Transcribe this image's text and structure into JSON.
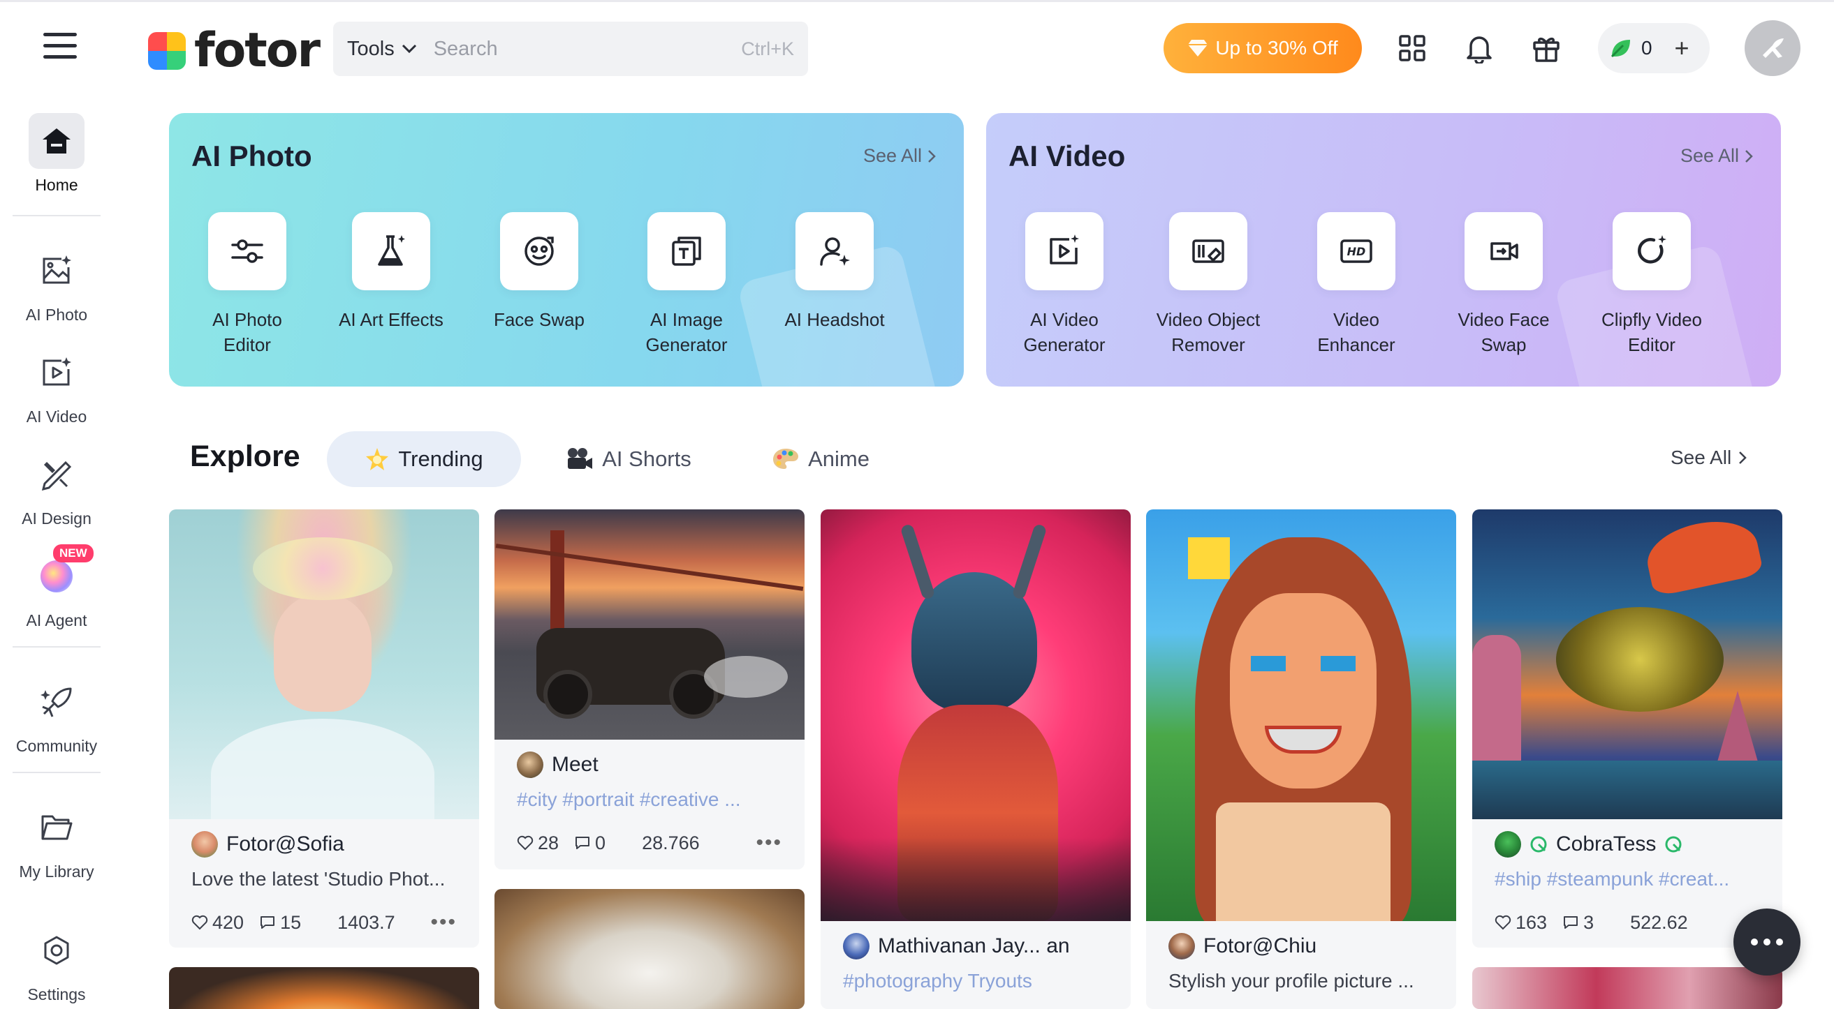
{
  "topbar": {
    "logo_text": "fotor",
    "tools_label": "Tools",
    "search_placeholder": "Search",
    "shortcut": "Ctrl+K",
    "promo_label": "Up to 30% Off",
    "credits": "0"
  },
  "sidebar": {
    "items": [
      {
        "label": "Home"
      },
      {
        "label": "AI Photo"
      },
      {
        "label": "AI Video"
      },
      {
        "label": "AI Design"
      },
      {
        "label": "AI Agent"
      },
      {
        "label": "Community"
      },
      {
        "label": "My Library"
      },
      {
        "label": "Settings"
      }
    ],
    "new_badge": "NEW"
  },
  "ai_photo": {
    "title": "AI Photo",
    "see_all": "See All",
    "tools": [
      {
        "line1": "AI Photo",
        "line2": "Editor",
        "icon": "sliders-icon"
      },
      {
        "line1": "AI Art Effects",
        "line2": "",
        "icon": "flask-icon"
      },
      {
        "line1": "Face Swap",
        "line2": "",
        "icon": "face-swap-icon"
      },
      {
        "line1": "AI Image",
        "line2": "Generator",
        "icon": "image-generator-icon"
      },
      {
        "line1": "AI Headshot",
        "line2": "",
        "icon": "headshot-icon"
      }
    ]
  },
  "ai_video": {
    "title": "AI Video",
    "see_all": "See All",
    "tools": [
      {
        "line1": "AI Video",
        "line2": "Generator",
        "icon": "video-generator-icon"
      },
      {
        "line1": "Video Object",
        "line2": "Remover",
        "icon": "object-remover-icon"
      },
      {
        "line1": "Video",
        "line2": "Enhancer",
        "icon": "hd-icon"
      },
      {
        "line1": "Video Face",
        "line2": "Swap",
        "icon": "video-face-swap-icon"
      },
      {
        "line1": "Clipfly Video",
        "line2": "Editor",
        "icon": "clipfly-icon"
      }
    ]
  },
  "explore": {
    "title": "Explore",
    "tabs": [
      {
        "label": "Trending",
        "active": true
      },
      {
        "label": "AI Shorts",
        "active": false
      },
      {
        "label": "Anime",
        "active": false
      }
    ],
    "see_all": "See All"
  },
  "cards": [
    {
      "author": "Fotor@Sofia",
      "desc": "Love the latest 'Studio Phot...",
      "likes": "420",
      "comments": "15",
      "score": "1403.7"
    },
    {
      "author": "Meet",
      "desc": "#city #portrait #creative ...",
      "likes": "28",
      "comments": "0",
      "score": "28.766"
    },
    {
      "author": "Mathivanan Jay... an",
      "desc": "#photography Tryouts"
    },
    {
      "author": "Fotor@Chiu",
      "desc": "Stylish your profile picture ..."
    },
    {
      "author": "CobraTess",
      "desc": "#ship #steampunk #creat...",
      "likes": "163",
      "comments": "3",
      "score": "522.62"
    }
  ],
  "colors": {
    "promo": "#ff9a2b",
    "tag": "#8aa2d8",
    "new_badge": "#ff3d6c"
  }
}
